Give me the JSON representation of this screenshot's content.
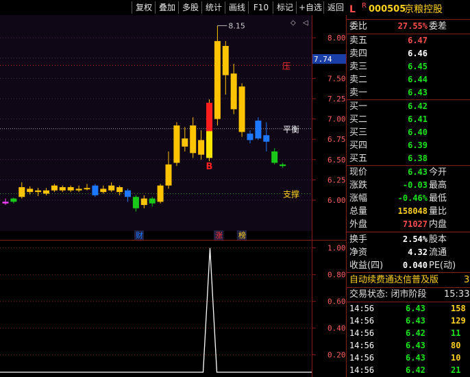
{
  "toolbar": {
    "buttons": [
      "复权",
      "叠加",
      "多股",
      "统计",
      "画线",
      "F10",
      "标记",
      "+自选",
      "返回"
    ]
  },
  "stock": {
    "prefix_l": "L",
    "prefix_r": "R",
    "code": "000505",
    "name": "京粮控股"
  },
  "order_ratio": {
    "label": "委比",
    "value": "27.55%",
    "label2": "委差"
  },
  "asks": [
    {
      "label": "卖五",
      "price": "6.47",
      "color": "red"
    },
    {
      "label": "卖四",
      "price": "6.46",
      "color": "white"
    },
    {
      "label": "卖三",
      "price": "6.45",
      "color": "green"
    },
    {
      "label": "卖二",
      "price": "6.44",
      "color": "green"
    },
    {
      "label": "卖一",
      "price": "6.43",
      "color": "green"
    }
  ],
  "bids": [
    {
      "label": "买一",
      "price": "6.42",
      "color": "green"
    },
    {
      "label": "买二",
      "price": "6.41",
      "color": "green"
    },
    {
      "label": "买三",
      "price": "6.40",
      "color": "green"
    },
    {
      "label": "买四",
      "price": "6.39",
      "color": "green"
    },
    {
      "label": "买五",
      "price": "6.38",
      "color": "green"
    }
  ],
  "quote": [
    {
      "label": "现价",
      "value": "6.43",
      "color": "green",
      "label2": "今开"
    },
    {
      "label": "涨跌",
      "value": "-0.03",
      "color": "green",
      "label2": "最高"
    },
    {
      "label": "涨幅",
      "value": "-0.46%",
      "color": "green",
      "label2": "最低"
    },
    {
      "label": "总量",
      "value": "158048",
      "color": "yellow",
      "label2": "量比"
    },
    {
      "label": "外盘",
      "value": "71027",
      "color": "red",
      "label2": "内盘"
    }
  ],
  "fundamentals": [
    {
      "label": "换手",
      "value": "2.54%",
      "label2": "股本"
    },
    {
      "label": "净资",
      "value": "4.32",
      "label2": "流通"
    },
    {
      "label": "收益(四)",
      "value": "0.040",
      "label2": "PE(动)"
    }
  ],
  "promo": {
    "text": "自动续费通达信普及版",
    "tail": "3"
  },
  "trade_status": {
    "text": "交易状态: 闭市阶段",
    "time": "15:33"
  },
  "ticks": [
    {
      "time": "14:56",
      "price": "6.43",
      "vol": "158",
      "vol_color": "yellow"
    },
    {
      "time": "14:56",
      "price": "6.43",
      "vol": "129",
      "vol_color": "yellow"
    },
    {
      "time": "14:56",
      "price": "6.42",
      "vol": "11",
      "vol_color": "green"
    },
    {
      "time": "14:56",
      "price": "6.43",
      "vol": "80",
      "vol_color": "yellow"
    },
    {
      "time": "14:56",
      "price": "6.43",
      "vol": "10",
      "vol_color": "yellow"
    },
    {
      "time": "14:56",
      "price": "6.42",
      "vol": "21",
      "vol_color": "green"
    }
  ],
  "chart_data": [
    {
      "type": "candlestick",
      "ylim": [
        5.62,
        8.28
      ],
      "yticks": [
        "8.00",
        "7.75",
        "7.50",
        "7.25",
        "7.00",
        "6.75",
        "6.50",
        "6.25",
        "6.00"
      ],
      "last_price_label": "7.74",
      "high_annotation": "8.15",
      "resistance": {
        "label": "压",
        "value": 7.66
      },
      "balance": {
        "label": "平衡",
        "value": 6.88
      },
      "support": {
        "label": "支撑",
        "value": 6.08
      },
      "signal_label": "B",
      "markers": [
        "财",
        "涨",
        "榜"
      ],
      "candles": [
        [
          5.98,
          5.96,
          6.02,
          5.94,
          "magenta"
        ],
        [
          5.98,
          6.02,
          6.03,
          5.96,
          "green"
        ],
        [
          6.04,
          6.16,
          6.22,
          6.02,
          "up"
        ],
        [
          6.1,
          6.14,
          6.17,
          6.07,
          "up"
        ],
        [
          6.12,
          6.1,
          6.15,
          6.05,
          "down"
        ],
        [
          6.08,
          6.12,
          6.15,
          6.06,
          "up"
        ],
        [
          6.12,
          6.18,
          6.2,
          6.1,
          "up"
        ],
        [
          6.16,
          6.12,
          6.18,
          6.1,
          "down"
        ],
        [
          6.12,
          6.16,
          6.18,
          6.1,
          "up"
        ],
        [
          6.14,
          6.12,
          6.18,
          6.1,
          "down"
        ],
        [
          6.15,
          6.15,
          6.2,
          6.12,
          "doji"
        ],
        [
          6.18,
          6.06,
          6.2,
          6.04,
          "blue"
        ],
        [
          6.1,
          6.14,
          6.18,
          6.08,
          "up"
        ],
        [
          6.18,
          6.12,
          6.22,
          6.1,
          "down"
        ],
        [
          6.16,
          6.1,
          6.18,
          6.06,
          "down"
        ],
        [
          6.12,
          6.04,
          6.14,
          5.98,
          "blue"
        ],
        [
          6.04,
          5.9,
          6.06,
          5.86,
          "green"
        ],
        [
          5.94,
          6.02,
          6.06,
          5.9,
          "up"
        ],
        [
          6.02,
          5.96,
          6.04,
          5.92,
          "green"
        ],
        [
          5.98,
          6.18,
          6.2,
          5.96,
          "up"
        ],
        [
          6.18,
          6.44,
          6.6,
          6.14,
          "up"
        ],
        [
          6.46,
          6.92,
          6.96,
          6.42,
          "up"
        ],
        [
          6.66,
          6.76,
          6.9,
          6.6,
          "up"
        ],
        [
          6.58,
          6.92,
          7.02,
          6.52,
          "up"
        ],
        [
          6.74,
          6.56,
          6.86,
          6.5,
          "up"
        ],
        [
          6.52,
          7.2,
          7.24,
          6.48,
          "signal"
        ],
        [
          7.0,
          7.96,
          8.15,
          6.92,
          "up"
        ],
        [
          7.9,
          7.54,
          7.96,
          7.3,
          "down"
        ],
        [
          7.56,
          7.12,
          7.68,
          7.06,
          "down"
        ],
        [
          7.4,
          6.84,
          7.44,
          6.78,
          "down"
        ],
        [
          6.82,
          6.74,
          6.86,
          6.7,
          "blue"
        ],
        [
          6.98,
          6.76,
          7.02,
          6.74,
          "blue"
        ],
        [
          6.8,
          6.72,
          6.96,
          6.6,
          "blue"
        ],
        [
          6.6,
          6.46,
          6.64,
          6.44,
          "green"
        ],
        [
          6.44,
          6.42,
          6.46,
          6.4,
          "green"
        ]
      ]
    },
    {
      "type": "line",
      "ylim": [
        0.06,
        1.06
      ],
      "yticks": [
        "1.00",
        "0.80",
        "0.60",
        "0.40",
        "0.20"
      ],
      "peak_index": 25,
      "peak_value": 1.0
    }
  ]
}
